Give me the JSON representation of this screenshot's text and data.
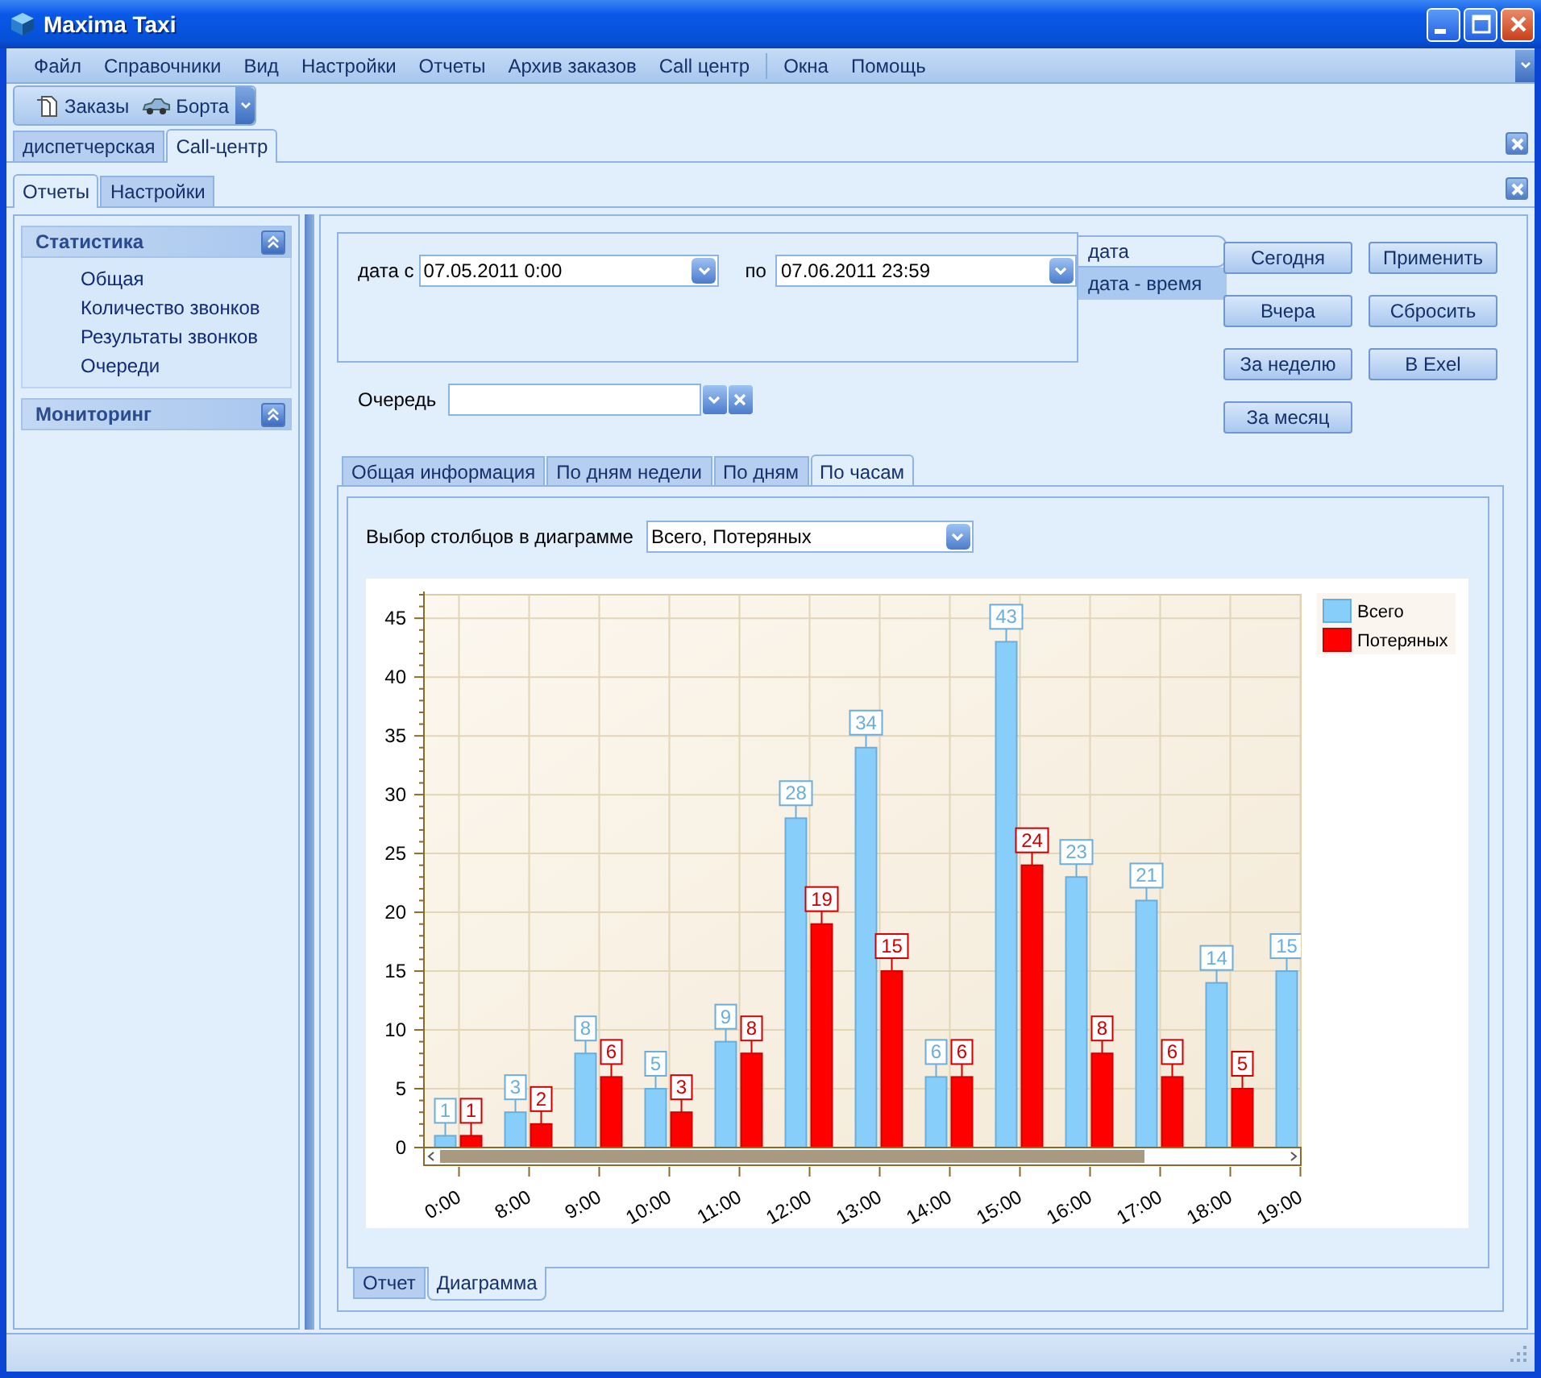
{
  "window": {
    "title": "Maxima Taxi"
  },
  "menu": {
    "groups": [
      [
        "Файл",
        "Справочники",
        "Вид",
        "Настройки",
        "Отчеты",
        "Архив заказов",
        "Call центр"
      ],
      [
        "Окна",
        "Помощь"
      ]
    ]
  },
  "toolbar": [
    {
      "label": "Заказы",
      "kind": "document"
    },
    {
      "label": "Борта",
      "kind": "car"
    }
  ],
  "doc_tabs": [
    {
      "label": "диспетчерская",
      "selected": false
    },
    {
      "label": "Call-центр",
      "selected": true
    }
  ],
  "sub_tabs": [
    {
      "label": "Отчеты",
      "selected": true
    },
    {
      "label": "Настройки",
      "selected": false
    }
  ],
  "sidebar": {
    "groups": [
      {
        "title": "Статистика",
        "items": [
          "Общая",
          "Количество звонков",
          "Результаты звонков",
          "Очереди"
        ]
      },
      {
        "title": "Мониторинг"
      }
    ]
  },
  "filter": {
    "date_from_label": "дата с",
    "date_from": "07.05.2011 0:00",
    "date_to_label": "по",
    "date_to": "07.06.2011 23:59",
    "mode_tabs": [
      {
        "label": "дата",
        "selected": true
      },
      {
        "label": "дата - время",
        "selected": false
      }
    ],
    "queue_label": "Очередь"
  },
  "buttons": [
    "Сегодня",
    "Применить",
    "Вчера",
    "Сбросить",
    "За неделю",
    "В Exel",
    "За месяц"
  ],
  "report_tabs": [
    {
      "label": "Общая информация",
      "selected": false
    },
    {
      "label": "По дням недели",
      "selected": false
    },
    {
      "label": "По дням",
      "selected": false
    },
    {
      "label": "По часам",
      "selected": true
    }
  ],
  "column_select": {
    "label": "Выбор столбцов в диаграмме",
    "value": "Всего, Потеряных"
  },
  "chart_data": {
    "type": "bar",
    "categories": [
      "0:00",
      "8:00",
      "9:00",
      "10:00",
      "11:00",
      "12:00",
      "13:00",
      "14:00",
      "15:00",
      "16:00",
      "17:00",
      "18:00",
      "19:00"
    ],
    "series": [
      {
        "name": "Всего",
        "color": "#87cefa",
        "values": [
          1,
          3,
          8,
          5,
          9,
          28,
          34,
          6,
          43,
          23,
          21,
          14,
          15
        ]
      },
      {
        "name": "Потеряных",
        "color": "#ff0000",
        "values": [
          1,
          2,
          6,
          3,
          8,
          19,
          15,
          6,
          24,
          8,
          6,
          5,
          null
        ]
      }
    ],
    "ylim": [
      0,
      47
    ],
    "yticks": [
      0,
      5,
      10,
      15,
      20,
      25,
      30,
      35,
      40,
      45
    ],
    "data_labels": true,
    "grid": true,
    "legend": true
  },
  "bottom_tabs": [
    {
      "label": "Отчет",
      "selected": false
    },
    {
      "label": "Диаграмма",
      "selected": true
    }
  ]
}
